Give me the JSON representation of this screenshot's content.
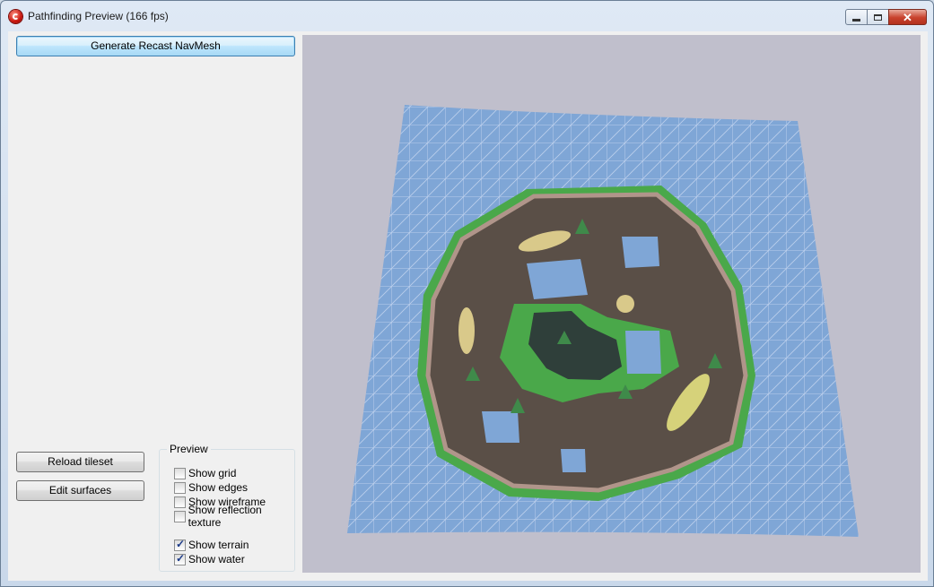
{
  "window": {
    "title": "Pathfinding Preview (166 fps)",
    "icon": "app-icon"
  },
  "caption_buttons": {
    "minimize": "minimize-icon",
    "maximize": "maximize-icon",
    "close": "close-icon"
  },
  "left_panel": {
    "generate_button": "Generate Recast NavMesh",
    "reload_button": "Reload tileset",
    "edit_button": "Edit surfaces"
  },
  "preview": {
    "label": "Preview",
    "options": [
      {
        "label": "Show grid",
        "checked": false
      },
      {
        "label": "Show edges",
        "checked": false
      },
      {
        "label": "Show wireframe",
        "checked": false
      },
      {
        "label": "Show reflection texture",
        "checked": false
      },
      {
        "label": "Show terrain",
        "checked": true
      },
      {
        "label": "Show water",
        "checked": true
      }
    ]
  },
  "colors": {
    "viewport_bg": "#c0bfcc",
    "navmesh": "#7fa6d6",
    "grass": "#4aa84a",
    "rock": "#5a4f47",
    "water": "#2f3f3a"
  }
}
